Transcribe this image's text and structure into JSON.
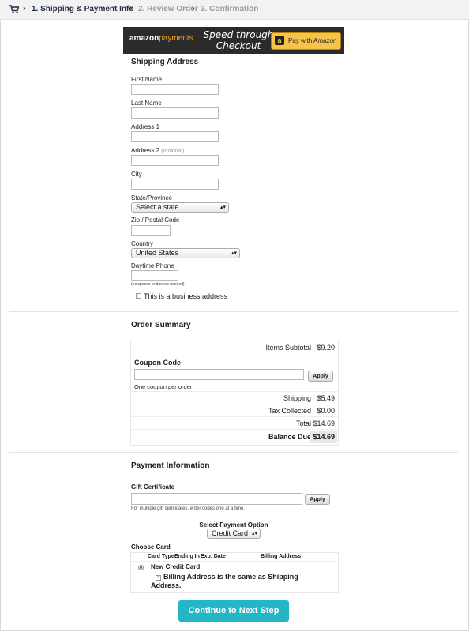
{
  "breadcrumb": {
    "steps": [
      {
        "label": "1. Shipping & Payment Info",
        "active": true
      },
      {
        "label": "2. Review Order",
        "active": false
      },
      {
        "label": "3. Confirmation",
        "active": false
      }
    ],
    "icon": "cart-icon"
  },
  "amazon": {
    "logo_bold": "amazon",
    "logo_rest": "payments",
    "tagline": "Speed through Checkout",
    "pay_button": "Pay with Amazon"
  },
  "shipping": {
    "title": "Shipping Address",
    "first_name": "First Name",
    "last_name": "Last Name",
    "address1": "Address 1",
    "address2": "Address 2",
    "address2_optional": "(optional)",
    "city": "City",
    "state": "State/Province",
    "state_value": "Select a state...",
    "zip": "Zip / Postal Code",
    "country": "Country",
    "country_value": "United States",
    "phone": "Daytime Phone",
    "phone_hint": "(no spaces or dashes needed)",
    "business_checkbox": "This is a business address"
  },
  "order": {
    "title": "Order Summary",
    "subtotal_label": "Items Subtotal",
    "subtotal_value": "$9.20",
    "coupon_title": "Coupon Code",
    "apply": "Apply",
    "coupon_note": "One coupon per order",
    "shipping_label": "Shipping",
    "shipping_value": "$5.49",
    "tax_label": "Tax Collected",
    "tax_value": "$0.00",
    "total_label": "Total",
    "total_value": "$14.69",
    "balance_label": "Balance Due",
    "balance_value": "$14.69"
  },
  "payment": {
    "title": "Payment Information",
    "gift_title": "Gift Certificate",
    "gift_apply": "Apply",
    "gift_note": "For multiple gift certificates, enter codes one at a time.",
    "select_title": "Select Payment Option",
    "select_value": "Credit Card",
    "choose_card": "Choose Card",
    "col_type": "Card Type",
    "col_ending": "Ending In",
    "col_exp": "Exp. Date",
    "col_billing": "Billing Address",
    "new_card": "New Credit Card",
    "billing_same": "Billing Address is the same as Shipping Address."
  },
  "cta": "Continue to Next Step",
  "colors": {
    "cta": "#25b6c6",
    "amazon_button": "#f7c44b",
    "banner": "#2b2b2b"
  }
}
